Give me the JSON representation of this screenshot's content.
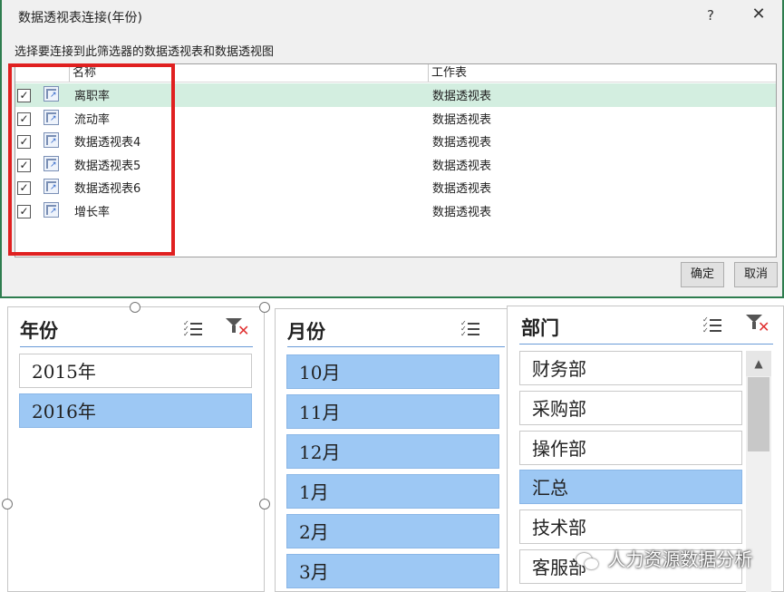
{
  "dialog": {
    "title": "数据透视表连接(年份)",
    "help": "?",
    "close": "✕",
    "instruction": "选择要连接到此筛选器的数据透视表和数据透视图",
    "col_name": "名称",
    "col_sheet": "工作表",
    "rows": [
      {
        "name": "离职率",
        "sheet": "数据透视表",
        "checked": "✓"
      },
      {
        "name": "流动率",
        "sheet": "数据透视表",
        "checked": "✓"
      },
      {
        "name": "数据透视表4",
        "sheet": "数据透视表",
        "checked": "✓"
      },
      {
        "name": "数据透视表5",
        "sheet": "数据透视表",
        "checked": "✓"
      },
      {
        "name": "数据透视表6",
        "sheet": "数据透视表",
        "checked": "✓"
      },
      {
        "name": "增长率",
        "sheet": "数据透视表",
        "checked": "✓"
      }
    ],
    "ok": "确定",
    "cancel": "取消"
  },
  "slicers": {
    "year": {
      "title": "年份",
      "items": [
        "2015年",
        "2016年"
      ],
      "selected": [
        false,
        true
      ]
    },
    "month": {
      "title": "月份",
      "items": [
        "10月",
        "11月",
        "12月",
        "1月",
        "2月",
        "3月"
      ]
    },
    "dept": {
      "title": "部门",
      "items": [
        "财务部",
        "采购部",
        "操作部",
        "汇总",
        "技术部",
        "客服部"
      ],
      "selected": [
        false,
        false,
        false,
        true,
        false,
        false
      ]
    }
  },
  "scrollbar": {
    "up": "▲"
  },
  "watermark": "人力资源数据分析",
  "colors": {
    "selected_item": "#9dc8f4",
    "highlight_box": "#e02020",
    "dialog_border": "#2e7d4f",
    "row_selected": "#d3eee0"
  }
}
